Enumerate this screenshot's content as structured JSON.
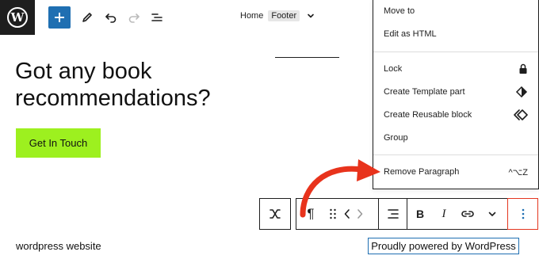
{
  "toolbar": {
    "breadcrumb_home": "Home",
    "breadcrumb_current": "Footer"
  },
  "content": {
    "heading": "Got any book recommendations?",
    "cta_label": "Get In Touch",
    "site_text": "wordpress website",
    "powered_text": "Proudly powered by WordPress"
  },
  "block_toolbar": {
    "paragraph_symbol": "¶",
    "bold_label": "B",
    "italic_label": "I"
  },
  "menu": {
    "items": [
      {
        "label": "Move to",
        "shortcut": ""
      },
      {
        "label": "Edit as HTML",
        "shortcut": ""
      },
      {
        "label": "Lock",
        "icon": "lock-icon"
      },
      {
        "label": "Create Template part",
        "icon": "template-part-icon"
      },
      {
        "label": "Create Reusable block",
        "icon": "reusable-block-icon"
      },
      {
        "label": "Group",
        "shortcut": ""
      },
      {
        "label": "Remove Paragraph",
        "shortcut": "^⌥Z"
      }
    ]
  },
  "colors": {
    "brand_blue": "#1f6fb2",
    "cta_green": "#9df01f",
    "highlight_red": "#e4361f",
    "arrow_red": "#e8331c"
  }
}
